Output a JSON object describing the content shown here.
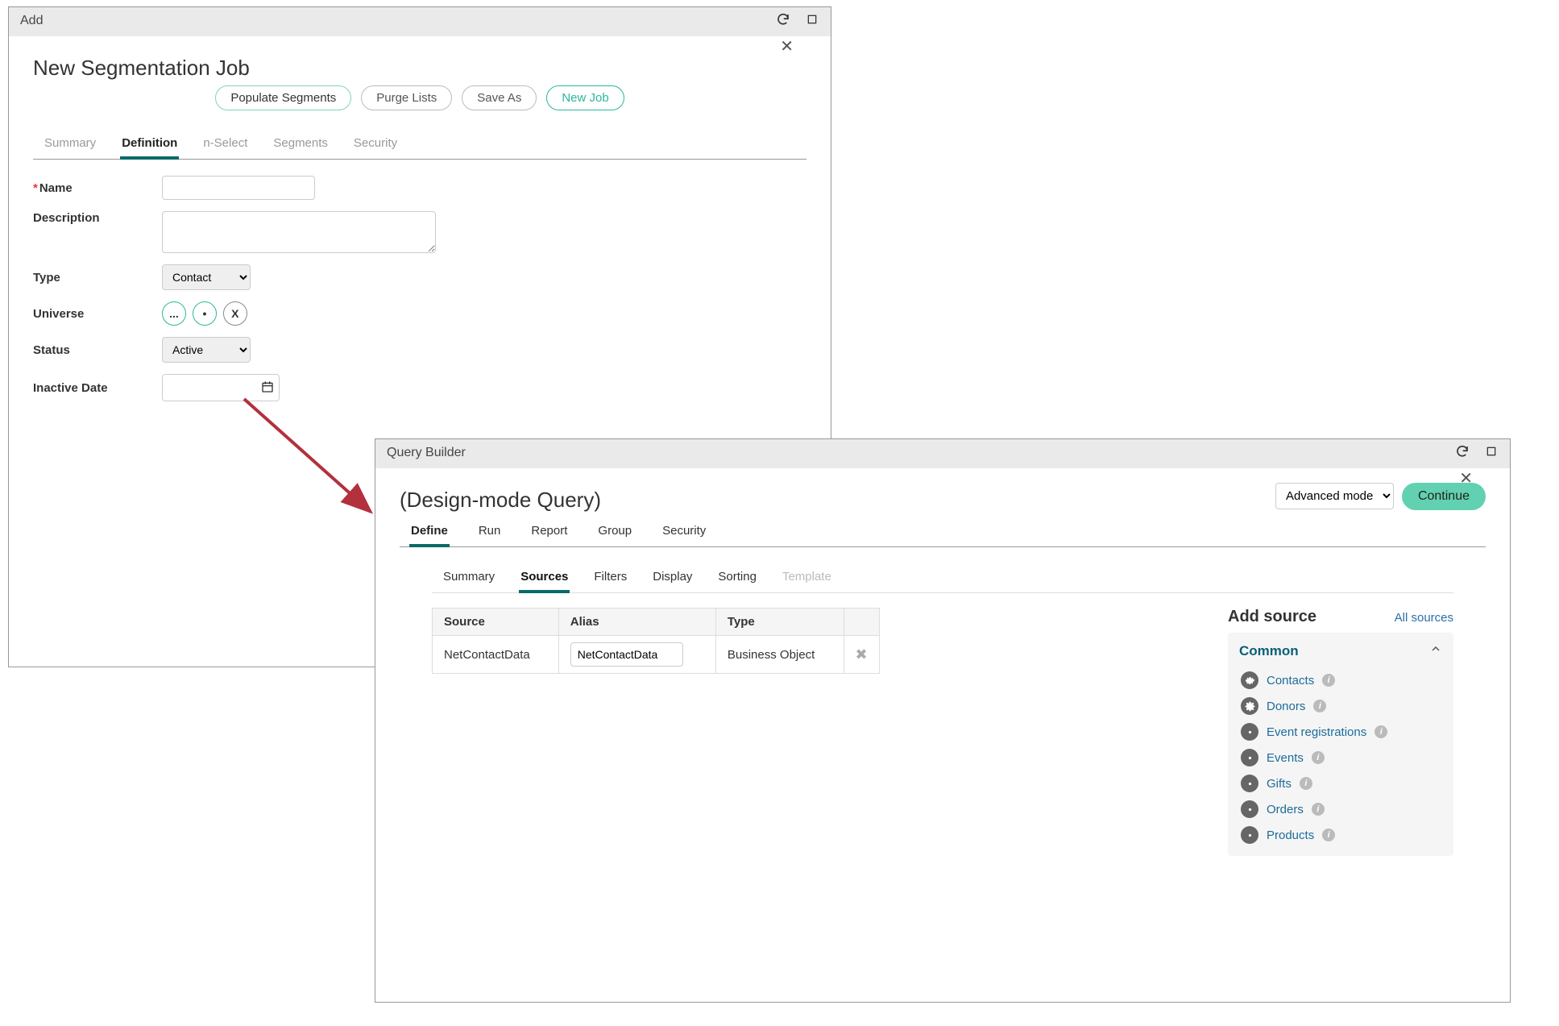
{
  "window1": {
    "title": "Add",
    "page_title": "New Segmentation Job",
    "actions": {
      "populate": "Populate Segments",
      "purge": "Purge Lists",
      "saveas": "Save As",
      "newjob": "New Job"
    },
    "tabs": {
      "summary": "Summary",
      "definition": "Definition",
      "nselect": "n-Select",
      "segments": "Segments",
      "security": "Security"
    },
    "form": {
      "name_label": "Name",
      "desc_label": "Description",
      "type_label": "Type",
      "type_value": "Contact",
      "universe_label": "Universe",
      "status_label": "Status",
      "status_value": "Active",
      "inactive_label": "Inactive Date",
      "btn_ellipsis": "...",
      "btn_dot": "•",
      "btn_x": "X"
    }
  },
  "window2": {
    "title": "Query Builder",
    "page_title": "(Design-mode Query)",
    "mode_value": "Advanced mode",
    "continue_label": "Continue",
    "tabs": {
      "define": "Define",
      "run": "Run",
      "report": "Report",
      "group": "Group",
      "security": "Security"
    },
    "subtabs": {
      "summary": "Summary",
      "sources": "Sources",
      "filters": "Filters",
      "display": "Display",
      "sorting": "Sorting",
      "template": "Template"
    },
    "table": {
      "headers": {
        "source": "Source",
        "alias": "Alias",
        "type": "Type"
      },
      "row": {
        "source": "NetContactData",
        "alias": "NetContactData",
        "type": "Business Object"
      }
    },
    "sidebar": {
      "title": "Add source",
      "all_link": "All sources",
      "category": "Common",
      "items": [
        "Contacts",
        "Donors",
        "Event registrations",
        "Events",
        "Gifts",
        "Orders",
        "Products"
      ]
    }
  }
}
